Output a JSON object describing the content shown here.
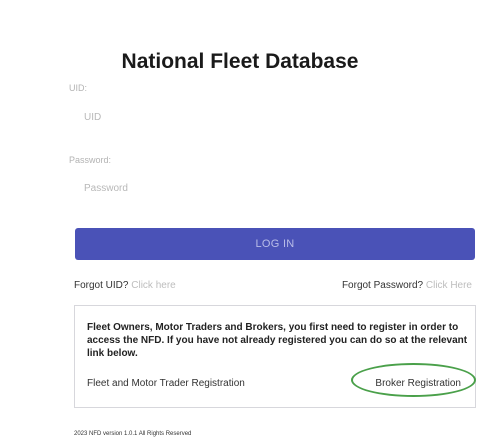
{
  "page_title": "National Fleet Database",
  "uid": {
    "label": "UID:",
    "placeholder": "UID"
  },
  "password": {
    "label": "Password:",
    "placeholder": "Password"
  },
  "login_button": "LOG IN",
  "forgot_uid": {
    "question": "Forgot UID?",
    "link": "Click here"
  },
  "forgot_password": {
    "question": "Forgot Password?",
    "link": "Click Here"
  },
  "registration": {
    "notice": "Fleet Owners, Motor Traders and Brokers, you first need to register in order to access the NFD. If you have not already registered you can do so at the relevant link below.",
    "fleet_link": "Fleet and Motor Trader Registration",
    "broker_link": "Broker Registration"
  },
  "highlight_color": "#4aa04a",
  "accent_color": "#4a52b7",
  "footer": "2023 NFD version 1.0.1 All Rights Reserved"
}
